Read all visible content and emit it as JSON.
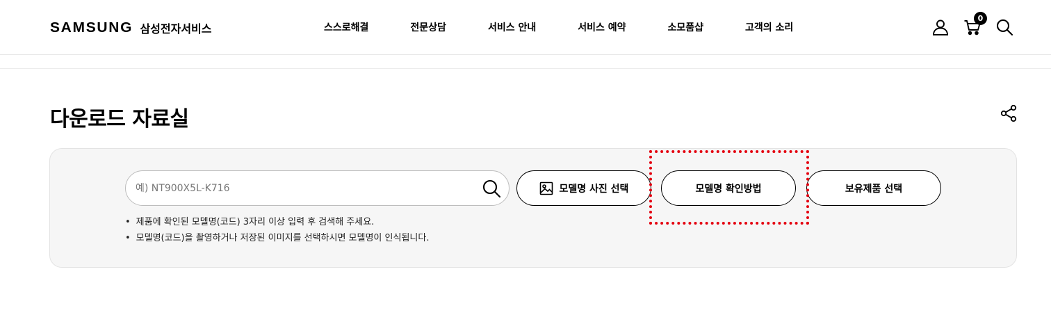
{
  "header": {
    "logo_word": "SAMSUNG",
    "logo_sub": "삼성전자서비스",
    "nav": [
      "스스로해결",
      "전문상담",
      "서비스 안내",
      "서비스 예약",
      "소모품샵",
      "고객의 소리"
    ],
    "cart_count": "0",
    "icons": [
      "user-icon",
      "cart-icon",
      "search-icon"
    ]
  },
  "page": {
    "title": "다운로드 자료실"
  },
  "search": {
    "placeholder": "예) NT900X5L-K716",
    "value": "",
    "photo_button_label": "모델명 사진 선택",
    "howto_button_label": "모델명 확인방법",
    "owned_button_label": "보유제품 선택",
    "notes": [
      "제품에 확인된 모델명(코드) 3자리 이상 입력 후 검색해 주세요.",
      "모델명(코드)을 촬영하거나 저장된 이미지를 선택하시면 모델명이 인식됩니다."
    ]
  },
  "colors": {
    "highlight": "#e4000f",
    "panel_bg": "#f6f6f6"
  }
}
